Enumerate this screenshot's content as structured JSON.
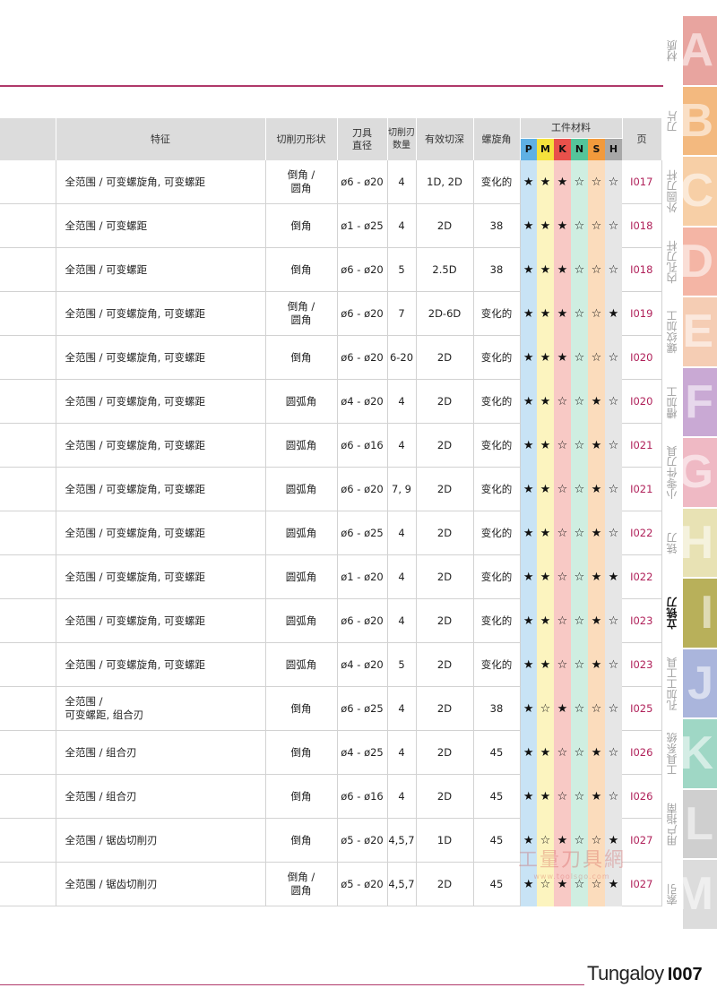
{
  "header": {
    "features": "特征",
    "edge_shape": "切削刃形状",
    "diameter": "刀具\n直径",
    "flutes": "切削刃\n数量",
    "depth": "有效切深",
    "helix": "螺旋角",
    "material_group": "工件材料",
    "page": "页",
    "materials": [
      {
        "label": "P",
        "color": "#5fb0e4"
      },
      {
        "label": "M",
        "color": "#f6e23c"
      },
      {
        "label": "K",
        "color": "#e8514b"
      },
      {
        "label": "N",
        "color": "#55c49a"
      },
      {
        "label": "S",
        "color": "#f29a3c"
      },
      {
        "label": "H",
        "color": "#a8a8a8"
      }
    ],
    "material_tints": [
      "#c8e3f5",
      "#fcf4bf",
      "#f8c9c5",
      "#cfeee1",
      "#fbdcbc",
      "#e6e6e6"
    ]
  },
  "rows": [
    {
      "features": "全范围 / 可变螺旋角, 可变螺距",
      "shape": "倒角 /\n圆角",
      "dia": "ø6 - ø20",
      "flutes": "4",
      "depth": "1D, 2D",
      "helix": "变化的",
      "ratings": "★★★☆☆☆",
      "page": "I017"
    },
    {
      "features": "全范围 / 可变螺距",
      "shape": "倒角",
      "dia": "ø1 - ø25",
      "flutes": "4",
      "depth": "2D",
      "helix": "38",
      "ratings": "★★★☆☆☆",
      "page": "I018"
    },
    {
      "features": "全范围 / 可变螺距",
      "shape": "倒角",
      "dia": "ø6 - ø20",
      "flutes": "5",
      "depth": "2.5D",
      "helix": "38",
      "ratings": "★★★☆☆☆",
      "page": "I018"
    },
    {
      "features": "全范围 / 可变螺旋角, 可变螺距",
      "shape": "倒角 /\n圆角",
      "dia": "ø6 - ø20",
      "flutes": "7",
      "depth": "2D-6D",
      "helix": "变化的",
      "ratings": "★★★☆☆★",
      "page": "I019"
    },
    {
      "features": "全范围 / 可变螺旋角, 可变螺距",
      "shape": "倒角",
      "dia": "ø6 - ø20",
      "flutes": "6-20",
      "depth": "2D",
      "helix": "变化的",
      "ratings": "★★★☆☆☆",
      "page": "I020"
    },
    {
      "features": "全范围 / 可变螺旋角, 可变螺距",
      "shape": "圆弧角",
      "dia": "ø4 - ø20",
      "flutes": "4",
      "depth": "2D",
      "helix": "变化的",
      "ratings": "★★☆☆★☆",
      "page": "I020"
    },
    {
      "features": "全范围 / 可变螺旋角, 可变螺距",
      "shape": "圆弧角",
      "dia": "ø6 - ø16",
      "flutes": "4",
      "depth": "2D",
      "helix": "变化的",
      "ratings": "★★☆☆★☆",
      "page": "I021"
    },
    {
      "features": "全范围 / 可变螺旋角, 可变螺距",
      "shape": "圆弧角",
      "dia": "ø6 - ø20",
      "flutes": "7, 9",
      "depth": "2D",
      "helix": "变化的",
      "ratings": "★★☆☆★☆",
      "page": "I021"
    },
    {
      "features": "全范围 / 可变螺旋角, 可变螺距",
      "shape": "圆弧角",
      "dia": "ø6 - ø25",
      "flutes": "4",
      "depth": "2D",
      "helix": "变化的",
      "ratings": "★★☆☆★☆",
      "page": "I022"
    },
    {
      "features": "全范围 / 可变螺旋角, 可变螺距",
      "shape": "圆弧角",
      "dia": "ø1 - ø20",
      "flutes": "4",
      "depth": "2D",
      "helix": "变化的",
      "ratings": "★★☆☆★★",
      "page": "I022"
    },
    {
      "features": "全范围 / 可变螺旋角, 可变螺距",
      "shape": "圆弧角",
      "dia": "ø6 - ø20",
      "flutes": "4",
      "depth": "2D",
      "helix": "变化的",
      "ratings": "★★☆☆★☆",
      "page": "I023"
    },
    {
      "features": "全范围 / 可变螺旋角, 可变螺距",
      "shape": "圆弧角",
      "dia": "ø4 - ø20",
      "flutes": "5",
      "depth": "2D",
      "helix": "变化的",
      "ratings": "★★☆☆★☆",
      "page": "I023"
    },
    {
      "features": "全范围 /\n可变螺距, 组合刃",
      "shape": "倒角",
      "dia": "ø6 - ø25",
      "flutes": "4",
      "depth": "2D",
      "helix": "38",
      "ratings": "★☆★☆☆☆",
      "page": "I025"
    },
    {
      "features": "全范围 / 组合刃",
      "shape": "倒角",
      "dia": "ø4 - ø25",
      "flutes": "4",
      "depth": "2D",
      "helix": "45",
      "ratings": "★★☆☆★☆",
      "page": "I026"
    },
    {
      "features": "全范围 / 组合刃",
      "shape": "倒角",
      "dia": "ø6 - ø16",
      "flutes": "4",
      "depth": "2D",
      "helix": "45",
      "ratings": "★★☆☆★☆",
      "page": "I026"
    },
    {
      "features": "全范围 / 锯齿切削刃",
      "shape": "倒角",
      "dia": "ø5 - ø20",
      "flutes": "4,5,7",
      "depth": "1D",
      "helix": "45",
      "ratings": "★☆★☆☆★",
      "page": "I027"
    },
    {
      "features": "全范围 / 锯齿切削刃",
      "shape": "倒角 /\n圆角",
      "dia": "ø5 - ø20",
      "flutes": "4,5,7",
      "depth": "2D",
      "helix": "45",
      "ratings": "★☆★☆☆★",
      "page": "I027"
    }
  ],
  "sidebar": [
    {
      "letter": "A",
      "label": "材质",
      "color": "#e8a49f",
      "active": false
    },
    {
      "letter": "B",
      "label": "刀片",
      "color": "#f3b97f",
      "active": false
    },
    {
      "letter": "C",
      "label": "外圆刀杆",
      "color": "#f7cfa6",
      "active": false
    },
    {
      "letter": "D",
      "label": "内孔刀杆",
      "color": "#f4b5a5",
      "active": false
    },
    {
      "letter": "E",
      "label": "螺纹加工",
      "color": "#f5cdb4",
      "active": false
    },
    {
      "letter": "F",
      "label": "槽加工",
      "color": "#c9a9d4",
      "active": false
    },
    {
      "letter": "G",
      "label": "小零件刀具",
      "color": "#efb9c4",
      "active": false
    },
    {
      "letter": "H",
      "label": "铣刀",
      "color": "#e8e2b4",
      "active": false
    },
    {
      "letter": "I",
      "label": "立铣刀",
      "color": "#b8b05a",
      "active": true
    },
    {
      "letter": "J",
      "label": "孔加工工具",
      "color": "#aab5dc",
      "active": false
    },
    {
      "letter": "K",
      "label": "工具系统",
      "color": "#9fd7c5",
      "active": false
    },
    {
      "letter": "L",
      "label": "用户指南",
      "color": "#cfcfcf",
      "active": false
    },
    {
      "letter": "M",
      "label": "索引",
      "color": "#dcdcdc",
      "active": false
    }
  ],
  "footer": {
    "brand": "Tungaloy",
    "page_number": "I007"
  },
  "watermark": {
    "line1": "工量刀具網",
    "line2": "www.toolsgo.com"
  }
}
